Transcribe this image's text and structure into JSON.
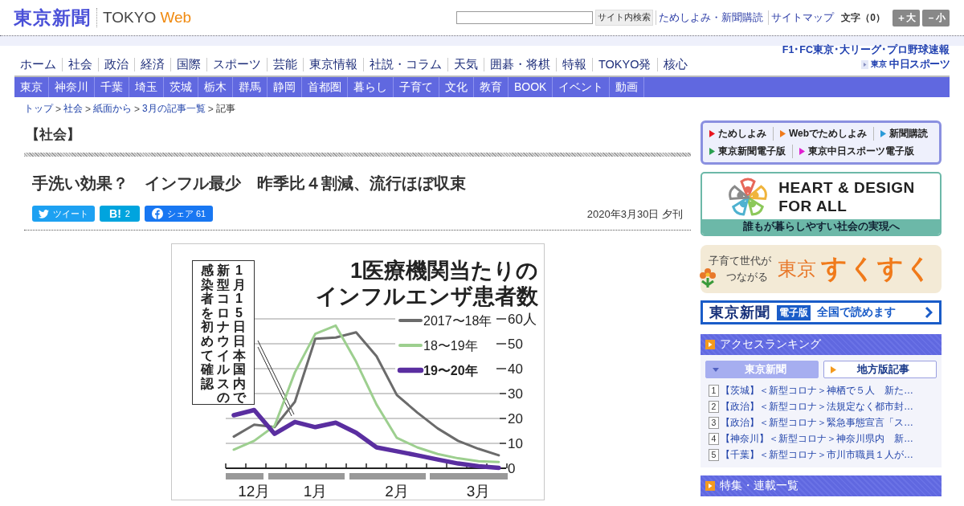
{
  "header": {
    "logo": "東京新聞",
    "brand": "TOKYO",
    "brand_accent": "Web",
    "search_button": "サイト内検索",
    "links": [
      "ためしよみ・新聞購読",
      "サイトマップ"
    ],
    "font_size_label": "文字（0）",
    "font_buttons": [
      "＋大",
      "－小"
    ]
  },
  "main_nav": [
    "ホーム",
    "社会",
    "政治",
    "経済",
    "国際",
    "スポーツ",
    "芸能",
    "東京情報",
    "社説・コラム",
    "天気",
    "囲碁・将棋",
    "特報",
    "TOKYO発",
    "核心"
  ],
  "chunichi": {
    "caption": "F1･FC東京･大リーグ･プロ野球速報",
    "logo_small": "東京",
    "logo": "中日スポーツ"
  },
  "region_nav": [
    "東京",
    "神奈川",
    "千葉",
    "埼玉",
    "茨城",
    "栃木",
    "群馬",
    "静岡",
    "首都圏",
    "暮らし",
    "子育て",
    "文化",
    "教育",
    "BOOK",
    "イベント",
    "動画"
  ],
  "breadcrumb": {
    "items": [
      "トップ",
      "社会",
      "紙面から",
      "3月の記事一覧",
      "記事"
    ],
    "separator": ">"
  },
  "article": {
    "section": "【社会】",
    "headline": "手洗い効果？　インフル最少　昨季比４割減、流行ほぼ収束",
    "share": [
      {
        "kind": "twitter",
        "label": "ツイート"
      },
      {
        "kind": "hatena",
        "label": "B!",
        "count": "2"
      },
      {
        "kind": "facebook",
        "label": "シェア",
        "count": "61"
      }
    ],
    "date": "2020年3月30日 夕刊",
    "figure": {
      "title_lines": [
        "1医療機関当たりの",
        "インフルエンザ患者数"
      ],
      "callout_columns": [
        "感染者を初めて確認",
        "新型コロナウイルスの",
        "1月15日日本国内で"
      ],
      "chart_data": {
        "type": "line",
        "categories": [
          null,
          "12月",
          null,
          null,
          "1月",
          null,
          null,
          null,
          "2月",
          null,
          null,
          null,
          "3月",
          null
        ],
        "series": [
          {
            "name": "2017〜18年",
            "color": "#6b6b6b",
            "values": [
              12.7,
              17.5,
              16.5,
              26.7,
              52,
              52.5,
              54.6,
              45,
              29.4,
              22.4,
              16,
              11,
              7.8,
              5.2
            ]
          },
          {
            "name": "18〜19年",
            "color": "#9dcf8f",
            "values": [
              7.5,
              11,
              17,
              38.5,
              54,
              57.3,
              42.8,
              25.6,
              12.2,
              8.4,
              5.7,
              4,
              2.8,
              2.5
            ]
          },
          {
            "name": "19〜20年",
            "color": "#5a2ea0",
            "values": [
              21.3,
              23.4,
              13.8,
              18.6,
              16.5,
              18.3,
              14.3,
              8.4,
              6.8,
              5.2,
              3.5,
              1.9,
              0.8,
              0.2
            ]
          }
        ],
        "grid": true,
        "legend": true,
        "ylim": [
          0,
          60
        ],
        "yticks": [
          0,
          10,
          20,
          30,
          40,
          50,
          {
            "value": 60,
            "label": "60人"
          }
        ]
      }
    }
  },
  "sidebar": {
    "promo_links": [
      {
        "label": "ためしよみ",
        "color": "#e8141e"
      },
      {
        "label": "Webでためしよみ",
        "color": "#f07a1a"
      },
      {
        "label": "新聞購読",
        "color": "#2a9ad8"
      },
      {
        "label": "東京新聞電子版",
        "color": "#2aa050"
      },
      {
        "label": "東京中日スポーツ電子版",
        "color": "#e020d0"
      }
    ],
    "heart_banner": {
      "lines": [
        "HEART & DESIGN",
        "FOR ALL"
      ],
      "caption": "誰もが暮らしやすい社会の実現へ"
    },
    "sukusuku_banner": {
      "lines": [
        "子育て世代が",
        "つながる"
      ],
      "logo_small": "東京",
      "logo": "すくすく"
    },
    "digital_banner": {
      "logo": "東京新聞",
      "tag": "電子版",
      "text": "全国で読めます"
    },
    "ranking": {
      "title": "アクセスランキング",
      "tabs": [
        {
          "label": "東京新聞",
          "selected": true
        },
        {
          "label": "地方版記事",
          "selected": false
        }
      ],
      "items": [
        {
          "rank": "1",
          "text": "【茨城】＜新型コロナ＞神栖で５人　新た…"
        },
        {
          "rank": "2",
          "text": "【政治】＜新型コロナ＞法規定なく都市封…"
        },
        {
          "rank": "3",
          "text": "【政治】＜新型コロナ＞緊急事態宣言「ス…"
        },
        {
          "rank": "4",
          "text": "【神奈川】＜新型コロナ＞神奈川県内　新…"
        },
        {
          "rank": "5",
          "text": "【千葉】＜新型コロナ＞市川市職員１人が…"
        }
      ]
    },
    "features": {
      "title": "特集・連載一覧"
    }
  }
}
